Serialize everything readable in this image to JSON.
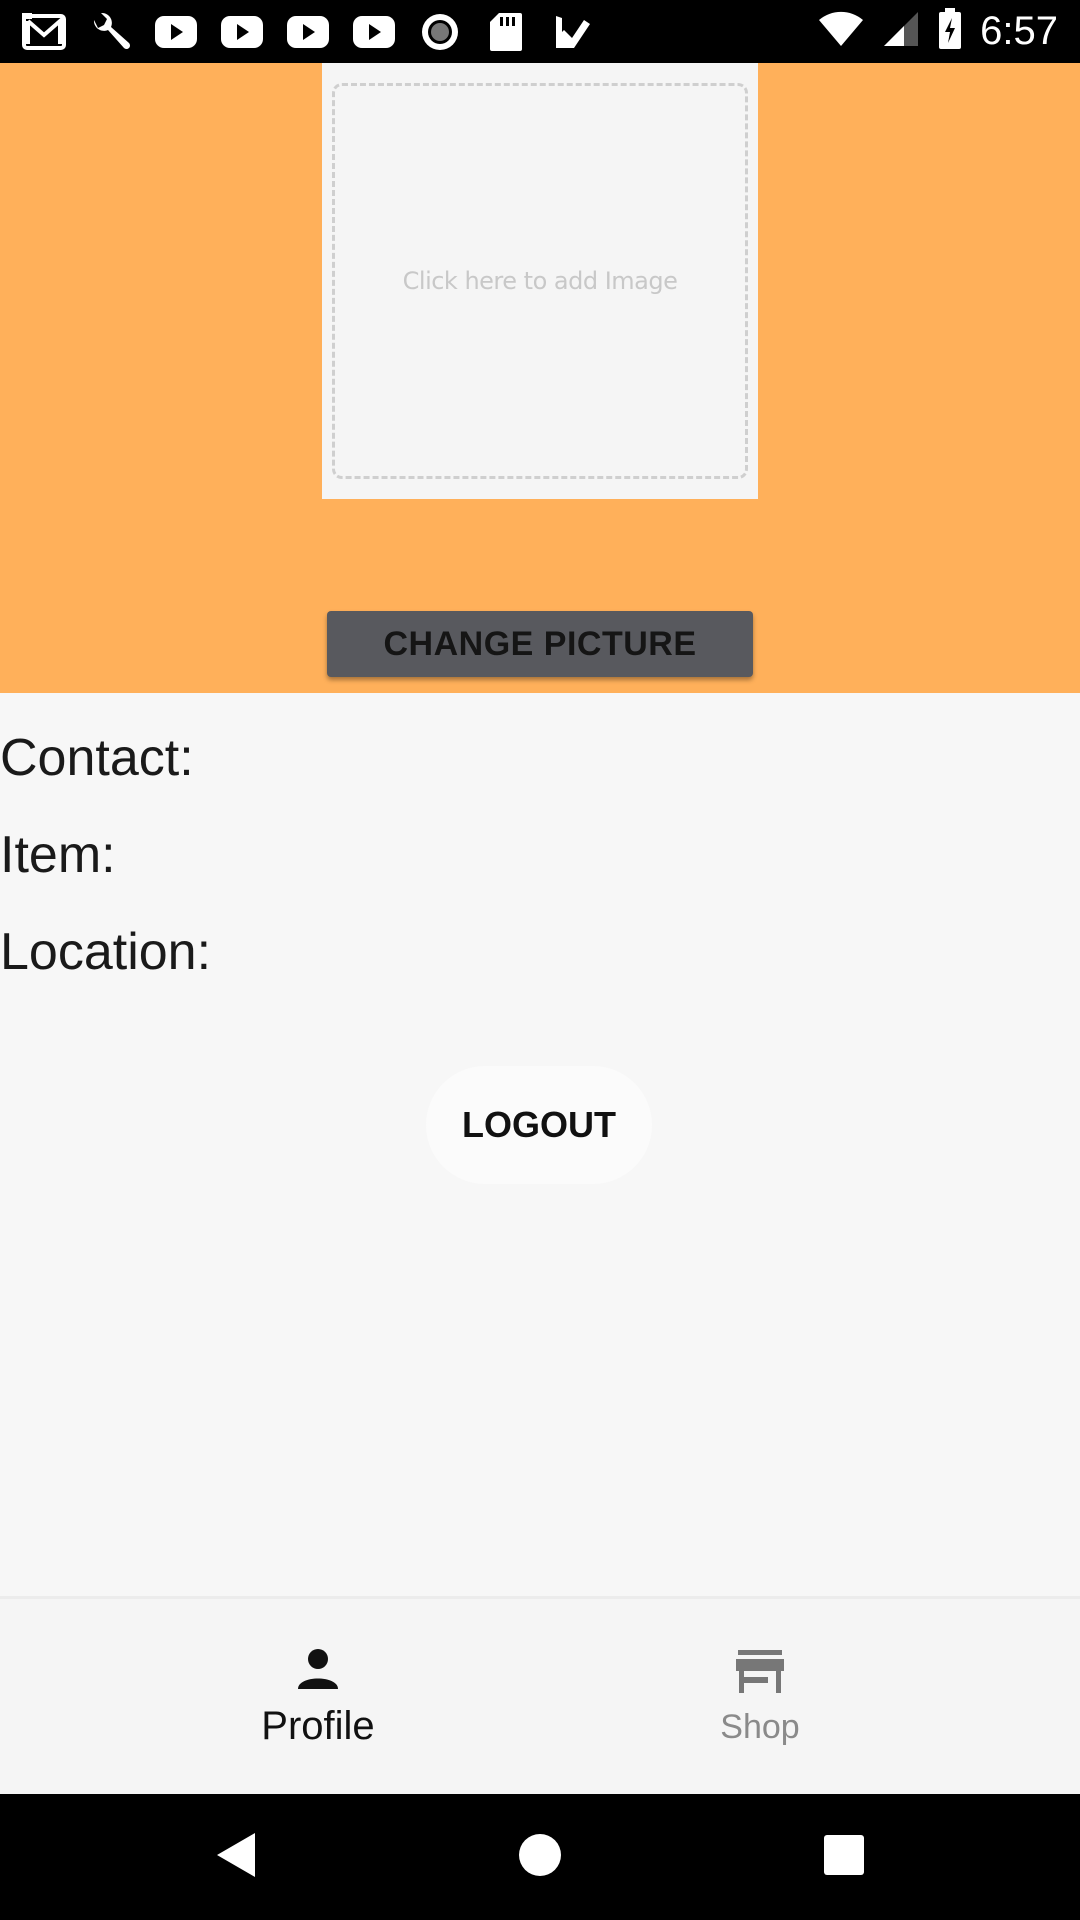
{
  "status_bar": {
    "time": "6:57",
    "icons": [
      "gmail-icon",
      "wrench-icon",
      "youtube-icon",
      "youtube-icon",
      "youtube-icon",
      "youtube-icon",
      "record-icon",
      "sd-card-icon",
      "checkmark-app-icon"
    ],
    "right_icons": [
      "wifi-icon",
      "signal-icon",
      "battery-charging-icon"
    ]
  },
  "header": {
    "image_placeholder": "Click here to add Image",
    "change_picture_label": "CHANGE PICTURE",
    "background_color": "#ffb05a"
  },
  "info": {
    "contact_label": "Contact:",
    "item_label": "Item:",
    "location_label": "Location:"
  },
  "logout_label": "LOGOUT",
  "bottom_nav": {
    "items": [
      {
        "label": "Profile",
        "icon": "person-icon",
        "active": true
      },
      {
        "label": "Shop",
        "icon": "store-icon",
        "active": false
      }
    ]
  },
  "system_nav": {
    "icons": [
      "back-icon",
      "home-icon",
      "recents-icon"
    ]
  }
}
